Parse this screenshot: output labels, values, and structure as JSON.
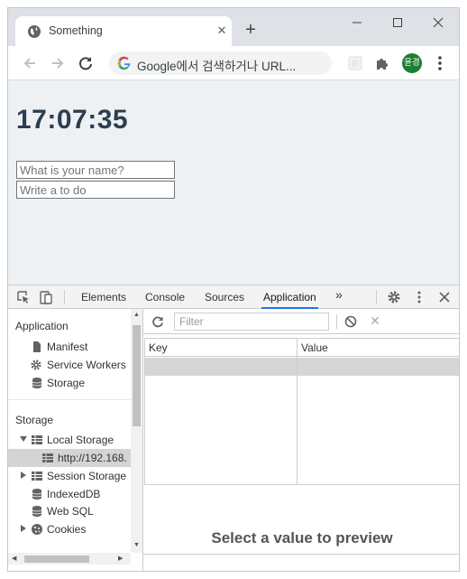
{
  "browser": {
    "tab_title": "Something",
    "omnibox_text": "Google에서 검색하거나 URL...",
    "profile_initials": "윤경"
  },
  "page": {
    "clock": "17:07:35",
    "name_placeholder": "What is your name?",
    "todo_placeholder": "Write a to do"
  },
  "devtools": {
    "tabs": [
      "Elements",
      "Console",
      "Sources",
      "Application"
    ],
    "active_tab": "Application",
    "sidebar": {
      "application_header": "Application",
      "application_items": [
        "Manifest",
        "Service Workers",
        "Storage"
      ],
      "storage_header": "Storage",
      "local_storage": "Local Storage",
      "local_storage_origin": "http://192.168.",
      "storage_items": [
        "Session Storage",
        "IndexedDB",
        "Web SQL",
        "Cookies"
      ]
    },
    "filter_placeholder": "Filter",
    "table": {
      "key_header": "Key",
      "value_header": "Value"
    },
    "preview_text": "Select a value to preview"
  },
  "icons": {
    "accent": "#1a73e8",
    "avatar_bg": "#1e7e34"
  }
}
